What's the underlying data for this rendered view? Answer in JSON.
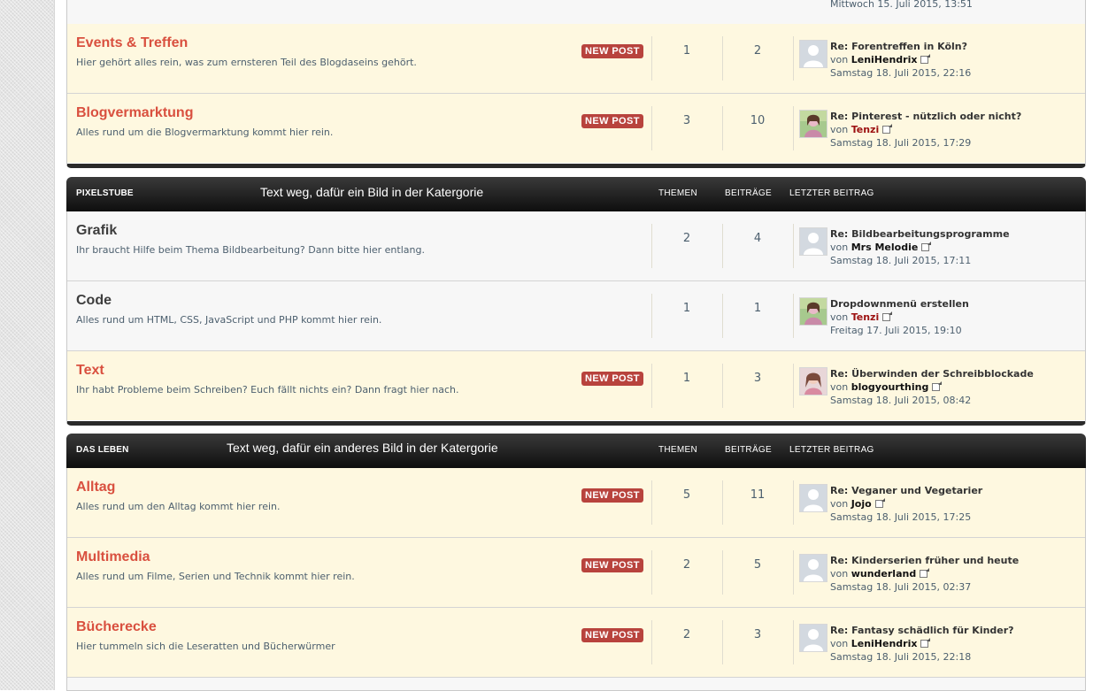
{
  "top_stub": {
    "date": "Mittwoch 15. Juli 2015, 13:51"
  },
  "group1": {
    "rows": [
      {
        "title": "Events & Treffen",
        "desc": "Hier gehört alles rein, was zum ernsteren Teil des Blogdaseins gehört.",
        "badge": "NEW POST",
        "topics": "1",
        "posts": "2",
        "last_title": "Re: Forentreffen in Köln?",
        "by": "von",
        "user": "LeniHendrix",
        "date": "Samstag 18. Juli 2015, 22:16"
      },
      {
        "title": "Blogvermarktung",
        "desc": "Alles rund um die Blogvermarktung kommt hier rein.",
        "badge": "NEW POST",
        "topics": "3",
        "posts": "10",
        "last_title": "Re: Pinterest - nützlich oder nicht?",
        "by": "von",
        "user": "Tenzi",
        "date": "Samstag 18. Juli 2015, 17:29"
      }
    ]
  },
  "cat_pixelstube": {
    "title": "PIXELSTUBE",
    "note": "Text weg, dafür ein Bild in der Katergorie",
    "col_topics": "THEMEN",
    "col_posts": "BEITRÄGE",
    "col_last": "LETZTER BEITRAG",
    "rows": [
      {
        "title": "Grafik",
        "desc": "Ihr braucht Hilfe beim Thema Bildbearbeitung? Dann bitte hier entlang.",
        "topics": "2",
        "posts": "4",
        "last_title": "Re: Bildbearbeitungsprogramme",
        "by": "von",
        "user": "Mrs Melodie",
        "date": "Samstag 18. Juli 2015, 17:11"
      },
      {
        "title": "Code",
        "desc": "Alles rund um HTML, CSS, JavaScript und PHP kommt hier rein.",
        "topics": "1",
        "posts": "1",
        "last_title": "Dropdownmenü erstellen",
        "by": "von",
        "user": "Tenzi",
        "date": "Freitag 17. Juli 2015, 19:10"
      },
      {
        "title": "Text",
        "desc": "Ihr habt Probleme beim Schreiben? Euch fällt nichts ein? Dann fragt hier nach.",
        "badge": "NEW POST",
        "topics": "1",
        "posts": "3",
        "last_title": "Re: Überwinden der Schreibblockade",
        "by": "von",
        "user": "blogyourthing",
        "date": "Samstag 18. Juli 2015, 08:42"
      }
    ]
  },
  "cat_leben": {
    "title": "DAS LEBEN",
    "note": "Text weg, dafür ein anderes Bild in der Katergorie",
    "col_topics": "THEMEN",
    "col_posts": "BEITRÄGE",
    "col_last": "LETZTER BEITRAG",
    "rows": [
      {
        "title": "Alltag",
        "desc": "Alles rund um den Alltag kommt hier rein.",
        "badge": "NEW POST",
        "topics": "5",
        "posts": "11",
        "last_title": "Re: Veganer und Vegetarier",
        "by": "von",
        "user": "Jojo",
        "date": "Samstag 18. Juli 2015, 17:25"
      },
      {
        "title": "Multimedia",
        "desc": "Alles rund um Filme, Serien und Technik kommt hier rein.",
        "badge": "NEW POST",
        "topics": "2",
        "posts": "5",
        "last_title": "Re: Kinderserien früher und heute",
        "by": "von",
        "user": "wunderland",
        "date": "Samstag 18. Juli 2015, 02:37"
      },
      {
        "title": "Bücherecke",
        "desc": "Hier tummeln sich die Leseratten und Bücherwürmer",
        "badge": "NEW POST",
        "topics": "2",
        "posts": "3",
        "last_title": "Re: Fantasy schädlich für Kinder?",
        "by": "von",
        "user": "LeniHendrix",
        "date": "Samstag 18. Juli 2015, 22:18"
      }
    ]
  },
  "colors": {
    "accent": "#d9503f",
    "badge": "#b8433d",
    "unread_bg": "#fef8e0",
    "read_bg": "#f7f7f7",
    "header_dark": "#1a1a1a",
    "user_red": "#9c1010"
  }
}
